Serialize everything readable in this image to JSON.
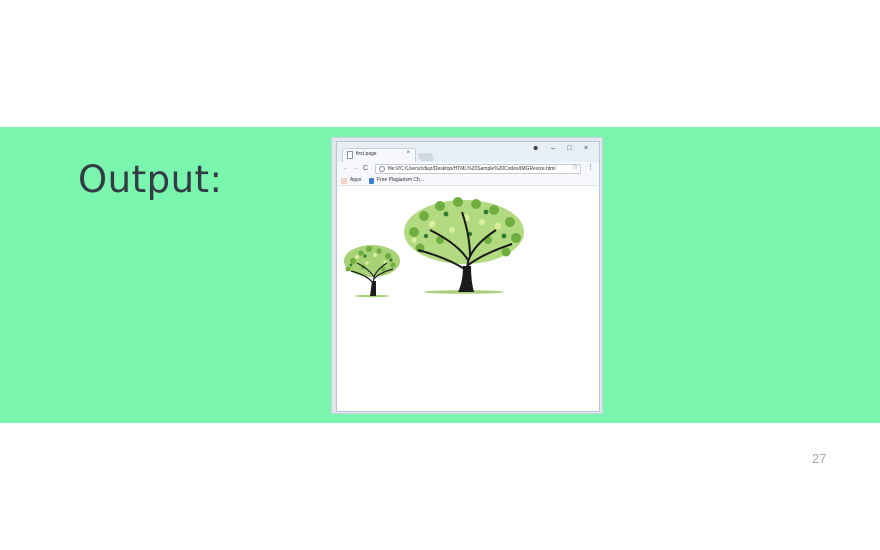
{
  "slide": {
    "heading": "Output:",
    "page_number": "27",
    "band_color": "#7af5ae"
  },
  "browser": {
    "tab_title": "first page",
    "tab_close": "×",
    "url": "file:///C:/Users/cdiaz/Desktop/HTML%20Sample%20Codes/IMGResize.html",
    "window_controls": {
      "account": "☻",
      "minimize": "–",
      "maximize": "□",
      "close": "×"
    },
    "nav": {
      "back": "←",
      "forward": "→",
      "reload": "C"
    },
    "star": "☆",
    "menu": "⋮",
    "bookmarks": [
      {
        "label": "Apps",
        "icon": "apps-grid-icon"
      },
      {
        "label": "Free Plagiarism Ch...",
        "icon": "bookmark-page-icon"
      }
    ],
    "content": {
      "images": [
        {
          "name": "small-tree-image",
          "icon": "tree-illustration"
        },
        {
          "name": "large-tree-image",
          "icon": "tree-illustration"
        }
      ]
    }
  }
}
